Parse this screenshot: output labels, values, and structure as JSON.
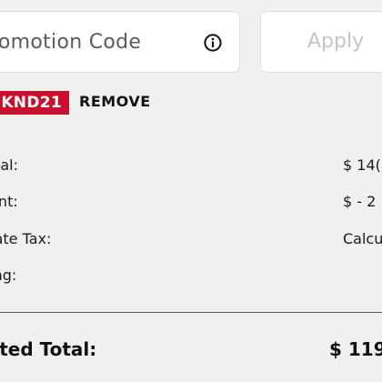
{
  "promo": {
    "input_placeholder": "romotion Code",
    "input_value": "",
    "info_icon": "info-circle-icon",
    "apply_label": "Apply"
  },
  "applied_code": {
    "code": "KND21",
    "remove_label": "REMOVE",
    "chip_color": "#c8102e"
  },
  "summary": {
    "subtotal_label": "total:",
    "subtotal_value": "$ 14(",
    "discount_label": "ount:",
    "discount_value": "$ - 2",
    "tax_label": "mate Tax:",
    "tax_value": "Calcu",
    "shipping_label": "ping:",
    "shipping_value": ""
  },
  "total": {
    "label": "imated Total:",
    "value": "$ 119"
  }
}
